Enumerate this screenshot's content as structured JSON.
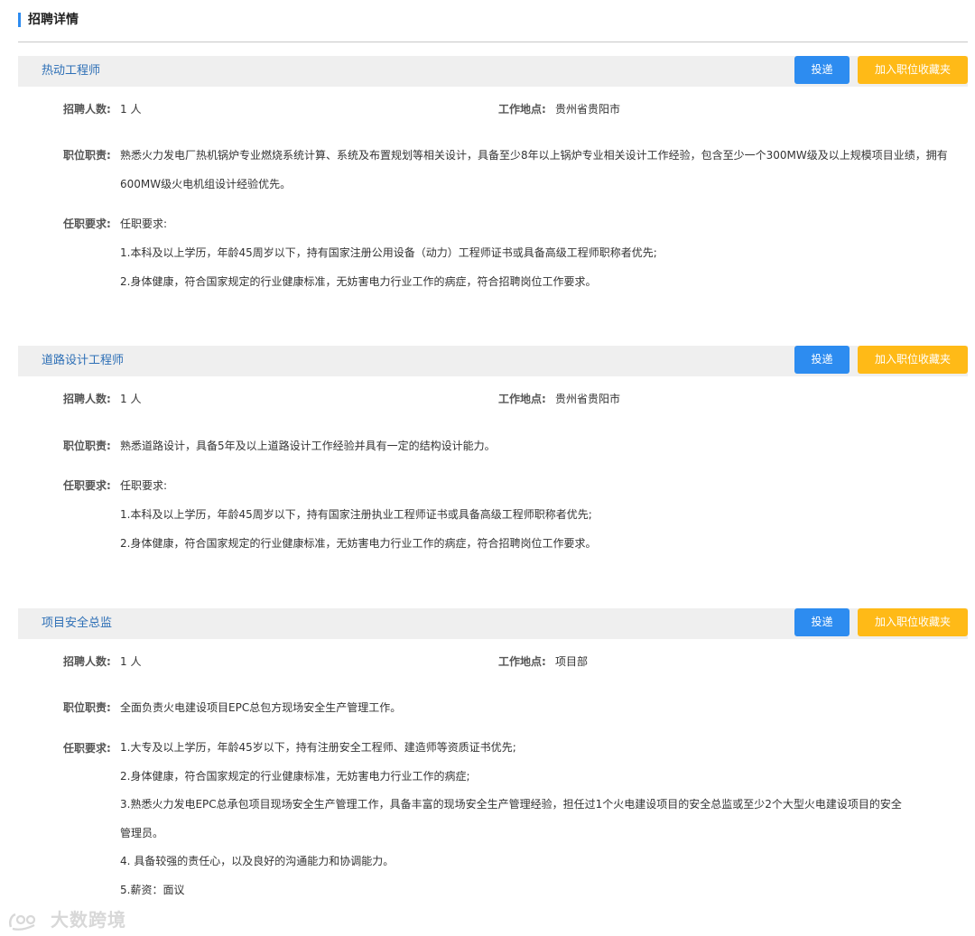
{
  "header": {
    "title": "招聘详情"
  },
  "actions": {
    "apply_label": "投递",
    "favorite_label": "加入职位收藏夹"
  },
  "labels": {
    "count": "招聘人数:",
    "location": "工作地点:",
    "duty": "职位职责:",
    "requirement": "任职要求:"
  },
  "jobs": [
    {
      "title": "热动工程师",
      "count": "1 人",
      "location": "贵州省贵阳市",
      "duty_lines": [
        "熟悉火力发电厂热机锅炉专业燃烧系统计算、系统及布置规划等相关设计，具备至少8年以上锅炉专业相关设计工作经验，包含至少一个300MW级及以上规模项目业绩，拥有",
        "600MW级火电机组设计经验优先。"
      ],
      "requirement_lines": [
        "任职要求:",
        "1.本科及以上学历，年龄45周岁以下，持有国家注册公用设备（动力）工程师证书或具备高级工程师职称者优先;",
        "2.身体健康，符合国家规定的行业健康标准，无妨害电力行业工作的病症，符合招聘岗位工作要求。"
      ]
    },
    {
      "title": "道路设计工程师",
      "count": "1 人",
      "location": "贵州省贵阳市",
      "duty_lines": [
        "熟悉道路设计，具备5年及以上道路设计工作经验并具有一定的结构设计能力。"
      ],
      "requirement_lines": [
        "任职要求:",
        "1.本科及以上学历，年龄45周岁以下，持有国家注册执业工程师证书或具备高级工程师职称者优先;",
        "2.身体健康，符合国家规定的行业健康标准，无妨害电力行业工作的病症，符合招聘岗位工作要求。"
      ]
    },
    {
      "title": "项目安全总监",
      "count": "1 人",
      "location": "项目部",
      "duty_lines": [
        "全面负责火电建设项目EPC总包方现场安全生产管理工作。"
      ],
      "requirement_lines": [
        "1.大专及以上学历，年龄45岁以下，持有注册安全工程师、建造师等资质证书优先;",
        "2.身体健康，符合国家规定的行业健康标准，无妨害电力行业工作的病症;",
        "3.熟悉火力发电EPC总承包项目现场安全生产管理工作，具备丰富的现场安全生产管理经验，担任过1个火电建设项目的安全总监或至少2个大型火电建设项目的安全",
        "管理员。",
        "4. 具备较强的责任心，以及良好的沟通能力和协调能力。",
        "5.薪资：面议"
      ]
    }
  ],
  "watermark": {
    "text": "大数跨境",
    "color": "#d8d8d8"
  }
}
